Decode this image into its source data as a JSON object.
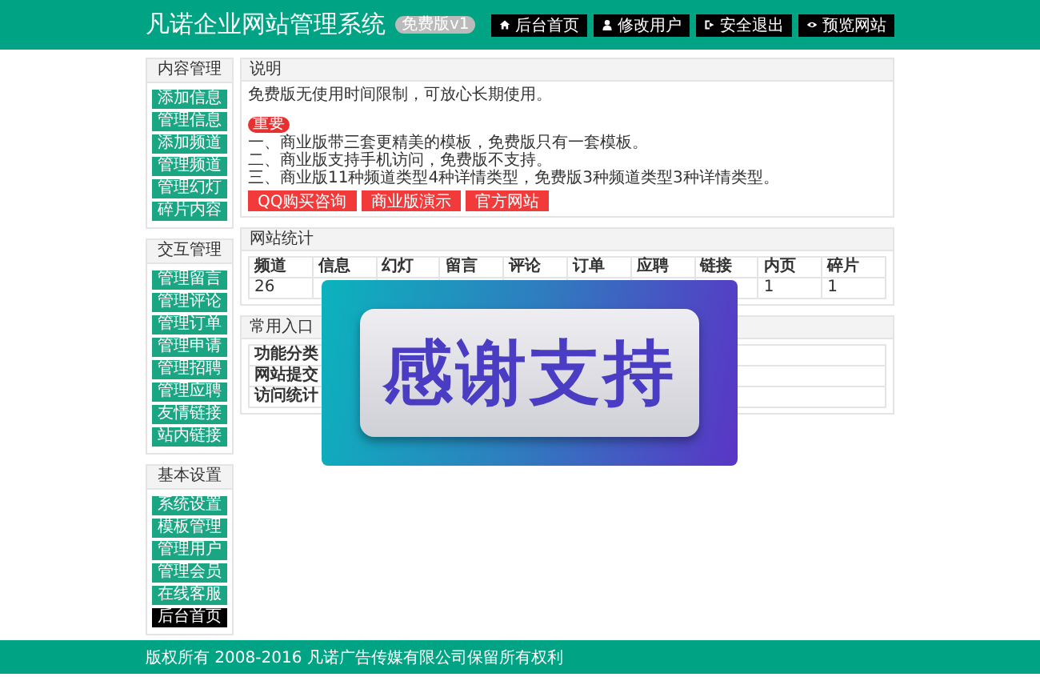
{
  "header": {
    "title": "凡诺企业网站管理系统",
    "badge": "免费版v1",
    "buttons": [
      {
        "label": "后台首页"
      },
      {
        "label": "修改用户"
      },
      {
        "label": "安全退出"
      },
      {
        "label": "预览网站"
      }
    ]
  },
  "sidebar": [
    {
      "title": "内容管理",
      "items": [
        {
          "label": "添加信息",
          "selected": false
        },
        {
          "label": "管理信息",
          "selected": false
        },
        {
          "label": "添加频道",
          "selected": false
        },
        {
          "label": "管理频道",
          "selected": false
        },
        {
          "label": "管理幻灯",
          "selected": false
        },
        {
          "label": "碎片内容",
          "selected": false
        }
      ]
    },
    {
      "title": "交互管理",
      "items": [
        {
          "label": "管理留言",
          "selected": false
        },
        {
          "label": "管理评论",
          "selected": false
        },
        {
          "label": "管理订单",
          "selected": false
        },
        {
          "label": "管理申请",
          "selected": false
        },
        {
          "label": "管理招聘",
          "selected": false
        },
        {
          "label": "管理应聘",
          "selected": false
        },
        {
          "label": "友情链接",
          "selected": false
        },
        {
          "label": "站内链接",
          "selected": false
        }
      ]
    },
    {
      "title": "基本设置",
      "items": [
        {
          "label": "系统设置",
          "selected": false
        },
        {
          "label": "模板管理",
          "selected": false
        },
        {
          "label": "管理用户",
          "selected": false
        },
        {
          "label": "管理会员",
          "selected": false
        },
        {
          "label": "在线客服",
          "selected": false
        },
        {
          "label": "后台首页",
          "selected": true
        }
      ]
    }
  ],
  "notice": {
    "title": "说明",
    "intro": "免费版无使用时间限制，可放心长期使用。",
    "tag": "重要",
    "lines": [
      "一、商业版带三套更精美的模板，免费版只有一套模板。",
      "二、商业版支持手机访问，免费版不支持。",
      "三、商业版11种频道类型4种详情类型，免费版3种频道类型3种详情类型。"
    ],
    "buttons": [
      "QQ购买咨询",
      "商业版演示",
      "官方网站"
    ]
  },
  "stats": {
    "title": "网站统计",
    "columns": [
      "频道",
      "信息",
      "幻灯",
      "留言",
      "评论",
      "订单",
      "应聘",
      "链接",
      "内页",
      "碎片"
    ],
    "row_start": [
      "26"
    ],
    "row_end": [
      "1",
      "1"
    ]
  },
  "entries": {
    "title": "常用入口",
    "rows": [
      "功能分类",
      "网站提交",
      "访问统计"
    ]
  },
  "overlay": {
    "text": "感谢支持"
  },
  "footer": {
    "text": "版权所有 2008-2016 凡诺广告传媒有限公司保留所有权利"
  }
}
